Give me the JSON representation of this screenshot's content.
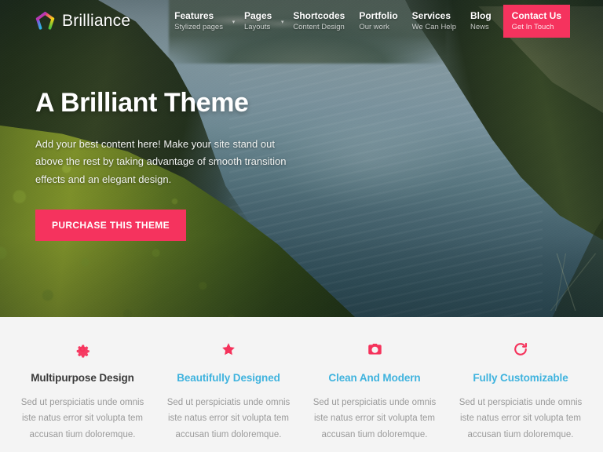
{
  "brand": {
    "name": "Brilliance",
    "logo_icon": "pentagon-rainbow-logo-icon",
    "logo_colors": [
      "#e8318a",
      "#f7d117",
      "#4cc23e",
      "#2fb5e8",
      "#8d3fd4"
    ]
  },
  "nav": {
    "items": [
      {
        "title": "Features",
        "sub": "Stylized pages",
        "has_caret": true,
        "cta": false
      },
      {
        "title": "Pages",
        "sub": "Layouts",
        "has_caret": true,
        "cta": false
      },
      {
        "title": "Shortcodes",
        "sub": "Content Design",
        "has_caret": false,
        "cta": false
      },
      {
        "title": "Portfolio",
        "sub": "Our work",
        "has_caret": false,
        "cta": false
      },
      {
        "title": "Services",
        "sub": "We Can Help",
        "has_caret": false,
        "cta": false
      },
      {
        "title": "Blog",
        "sub": "News",
        "has_caret": false,
        "cta": false
      },
      {
        "title": "Contact Us",
        "sub": "Get In Touch",
        "has_caret": false,
        "cta": true
      }
    ],
    "caret_glyph": "▾"
  },
  "hero": {
    "title": "A Brilliant Theme",
    "subtitle": "Add your best content here! Make your site stand out above the rest by taking advantage of smooth transition effects and an elegant design.",
    "button_label": "PURCHASE THIS THEME",
    "background_description": "Aerial photo of a fjord: blue-grey water winding between dark green forested mountain slopes"
  },
  "features": {
    "items": [
      {
        "icon": "gear-icon",
        "title": "Multipurpose Design",
        "title_color": "#3a3a3a",
        "desc": "Sed ut perspiciatis unde omnis iste natus error sit volupta tem accusan tium doloremque."
      },
      {
        "icon": "star-icon",
        "title": "Beautifully Designed",
        "title_color": "#3fb3de",
        "desc": "Sed ut perspiciatis unde omnis iste natus error sit volupta tem accusan tium doloremque."
      },
      {
        "icon": "camera-icon",
        "title": "Clean And Modern",
        "title_color": "#3fb3de",
        "desc": "Sed ut perspiciatis unde omnis iste natus error sit volupta tem accusan tium doloremque."
      },
      {
        "icon": "refresh-icon",
        "title": "Fully Customizable",
        "title_color": "#3fb3de",
        "desc": "Sed ut perspiciatis unde omnis iste natus error sit volupta tem accusan tium doloremque."
      }
    ],
    "icon_color": "#f5325b",
    "background_color": "#f4f4f4"
  },
  "theme": {
    "accent_pink": "#f5335e",
    "accent_cyan": "#3fb3de",
    "body_text": "#9a9a9a"
  }
}
